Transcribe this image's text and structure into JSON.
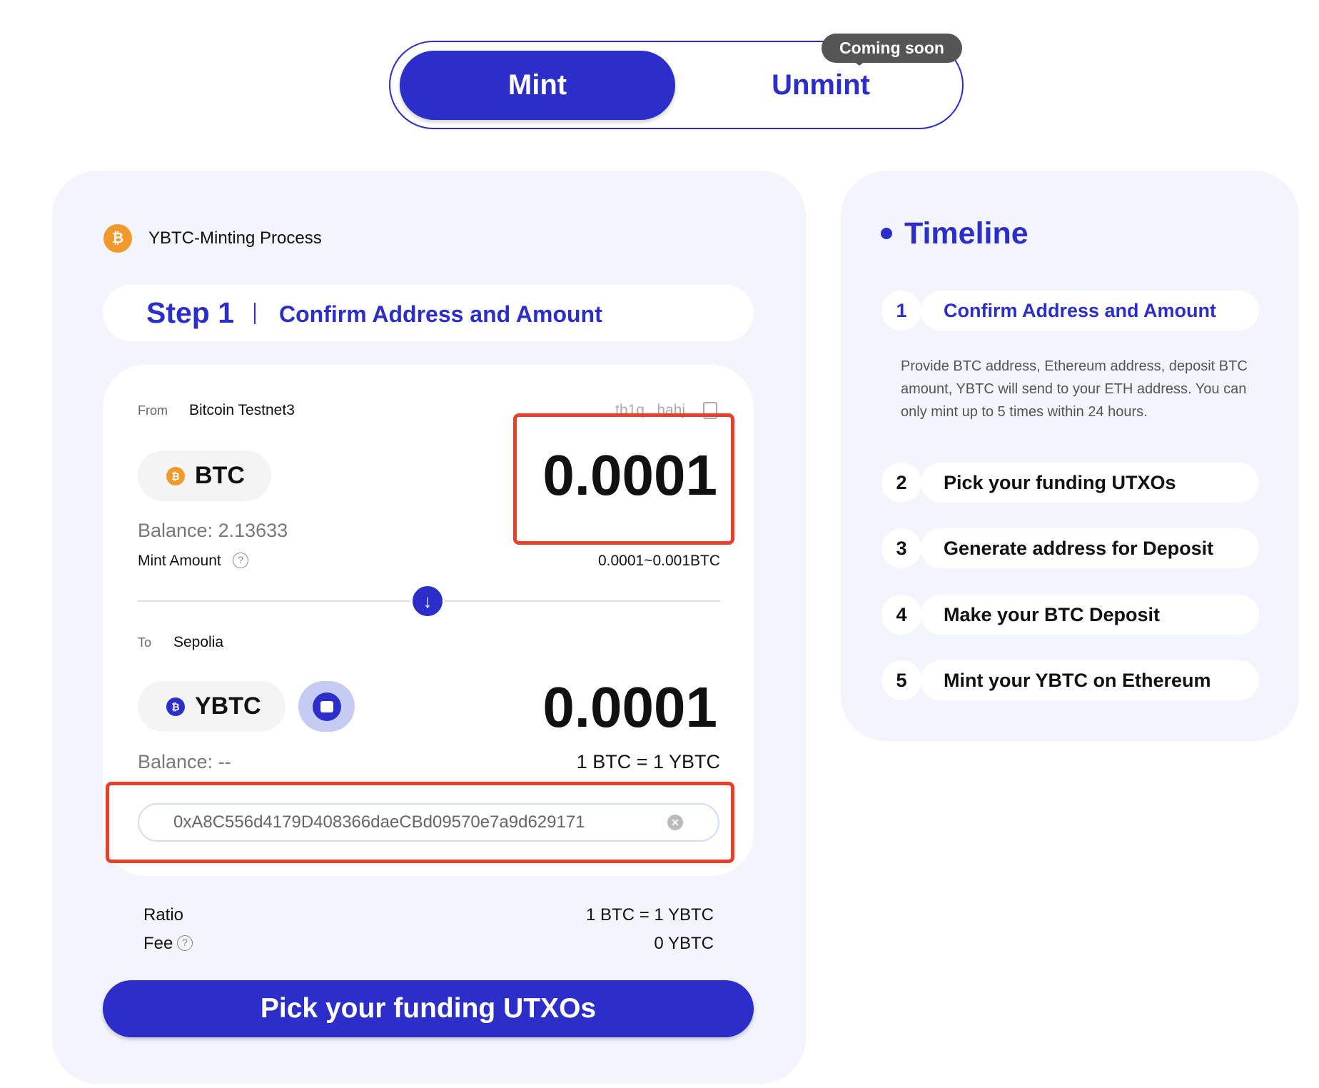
{
  "tabs": {
    "mint": "Mint",
    "unmint": "Unmint",
    "badge": "Coming soon"
  },
  "process": {
    "title": "YBTC-Minting Process",
    "step": "Step 1",
    "step_title": "Confirm Address and Amount"
  },
  "from": {
    "label": "From",
    "network": "Bitcoin Testnet3",
    "address": "tb1q...hahj",
    "token": "BTC",
    "amount": "0.0001",
    "balance": "Balance: 2.13633",
    "mint_amount_label": "Mint Amount",
    "range": "0.0001~0.001BTC"
  },
  "to": {
    "label": "To",
    "network": "Sepolia",
    "token": "YBTC",
    "amount": "0.0001",
    "balance": "Balance: --",
    "rate": "1 BTC = 1 YBTC",
    "address_value": "0xA8C556d4179D408366daeCBd09570e7a9d629171"
  },
  "summary": {
    "ratio_label": "Ratio",
    "ratio_value": "1 BTC = 1 YBTC",
    "fee_label": "Fee",
    "fee_value": "0 YBTC"
  },
  "cta": "Pick your funding UTXOs",
  "timeline": {
    "title": "Timeline",
    "description": "Provide BTC address, Ethereum address, deposit BTC amount, YBTC will send to your ETH address. You can only mint up to 5 times within 24 hours.",
    "items": [
      {
        "num": "1",
        "label": "Confirm Address and Amount"
      },
      {
        "num": "2",
        "label": "Pick your funding UTXOs"
      },
      {
        "num": "3",
        "label": "Generate address for Deposit"
      },
      {
        "num": "4",
        "label": "Make your BTC Deposit"
      },
      {
        "num": "5",
        "label": "Mint your YBTC on Ethereum"
      }
    ]
  },
  "colors": {
    "accent": "#2b2ec8",
    "btc": "#f09a2e",
    "highlight": "#e8402a",
    "card_bg": "#f3f4fc"
  }
}
